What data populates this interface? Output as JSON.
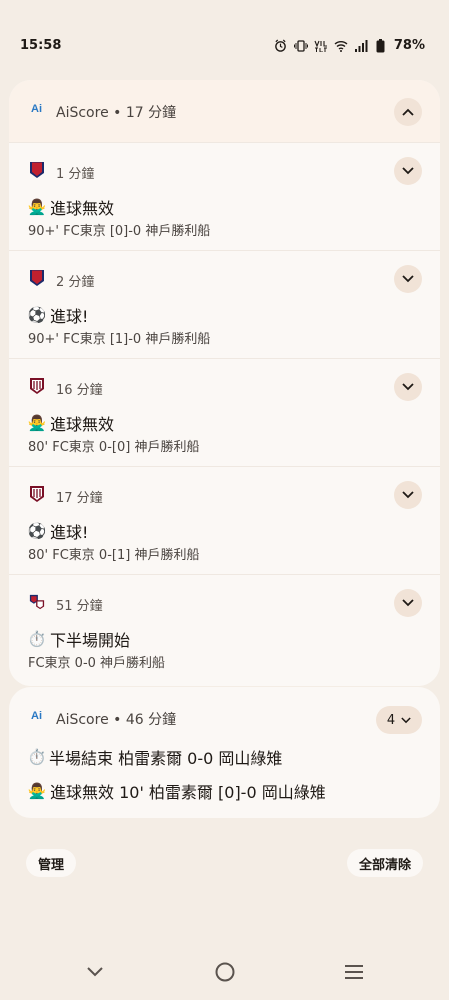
{
  "status_bar": {
    "time": "15:58",
    "battery": "78%"
  },
  "group1": {
    "app_icon": "Ai",
    "header": "AiScore • 17 分鐘",
    "notifications": [
      {
        "team_icon": "fc-tokyo-crest-icon",
        "time": "1 分鐘",
        "emoji": "🙅‍♂️",
        "title": "進球無效",
        "desc": "90+' FC東京 [0]-0 神戶勝利船"
      },
      {
        "team_icon": "fc-tokyo-crest-icon",
        "time": "2 分鐘",
        "emoji": "⚽",
        "title": "進球!",
        "desc": "90+' FC東京 [1]-0 神戶勝利船"
      },
      {
        "team_icon": "vissel-kobe-crest-icon",
        "time": "16 分鐘",
        "emoji": "🙅‍♂️",
        "title": "進球無效",
        "desc": "80' FC東京 0-[0] 神戶勝利船"
      },
      {
        "team_icon": "vissel-kobe-crest-icon",
        "time": "17 分鐘",
        "emoji": "⚽",
        "title": "進球!",
        "desc": "80' FC東京 0-[1] 神戶勝利船"
      },
      {
        "team_icon": "both-teams-crest-icon",
        "time": "51 分鐘",
        "emoji": "⏱️",
        "title": "下半場開始",
        "desc": "FC東京 0-0 神戶勝利船"
      }
    ]
  },
  "group2": {
    "app_icon": "Ai",
    "header": "AiScore • 46 分鐘",
    "count": "4",
    "line1_emoji": "⏱️",
    "line1": "半場結束 柏雷素爾 0-0 岡山綠雉",
    "line2_emoji": "🙅‍♂️",
    "line2": "進球無效 10' 柏雷素爾 [0]-0 岡山綠雉"
  },
  "actions": {
    "manage": "管理",
    "clear_all": "全部清除"
  },
  "colors": {
    "background": "#f4ede5",
    "card": "#fbf8f5",
    "chip": "#f1e3d7",
    "accent": "#2a79c4"
  }
}
